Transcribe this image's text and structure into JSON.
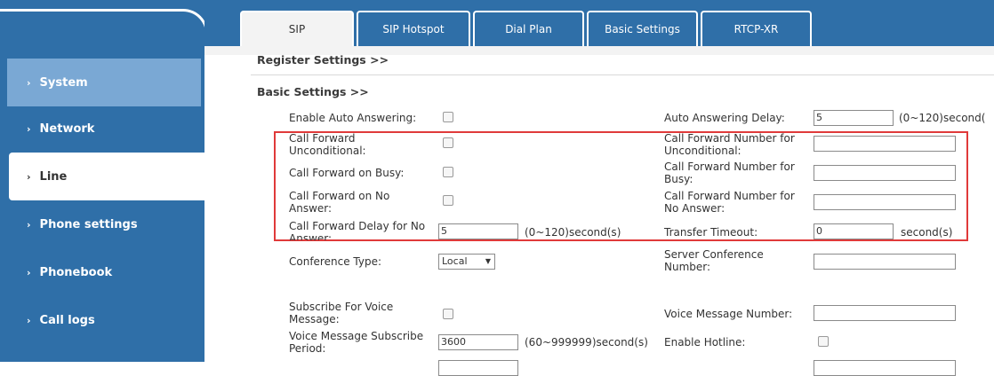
{
  "sidebar": {
    "items": [
      {
        "label": "System"
      },
      {
        "label": "Network"
      },
      {
        "label": "Line"
      },
      {
        "label": "Phone settings"
      },
      {
        "label": "Phonebook"
      },
      {
        "label": "Call logs"
      }
    ]
  },
  "tabs": [
    {
      "label": "SIP"
    },
    {
      "label": "SIP Hotspot"
    },
    {
      "label": "Dial Plan"
    },
    {
      "label": "Basic Settings"
    },
    {
      "label": "RTCP-XR"
    }
  ],
  "sections": {
    "register": "Register Settings >>",
    "basic": "Basic Settings >>"
  },
  "form": {
    "auto_answer": {
      "label": "Enable Auto Answering:"
    },
    "auto_answer_delay": {
      "label": "Auto Answering Delay:",
      "value": "5",
      "unit": "(0~120)second("
    },
    "cf_uncond": {
      "label1": "Call Forward",
      "label2": "Unconditional:"
    },
    "cf_uncond_num": {
      "label1": "Call Forward Number for",
      "label2": "Unconditional:"
    },
    "cf_busy": {
      "label": "Call Forward on Busy:"
    },
    "cf_busy_num": {
      "label1": "Call Forward Number for",
      "label2": "Busy:"
    },
    "cf_noans": {
      "label1": "Call Forward on No",
      "label2": "Answer:"
    },
    "cf_noans_num": {
      "label1": "Call Forward Number for",
      "label2": "No Answer:"
    },
    "cf_delay": {
      "label1": "Call Forward Delay for No",
      "label2": "Answer:",
      "value": "5",
      "unit": "(0~120)second(s)"
    },
    "transfer_timeout": {
      "label": "Transfer Timeout:",
      "value": "0",
      "unit": "second(s)"
    },
    "conference_type": {
      "label": "Conference Type:",
      "value": "Local",
      "arrow": "▼"
    },
    "server_conf_num": {
      "label1": "Server Conference",
      "label2": "Number:"
    },
    "subscribe_voice": {
      "label1": "Subscribe For Voice",
      "label2": "Message:"
    },
    "voice_msg_num": {
      "label": "Voice Message Number:"
    },
    "vm_subscribe_period": {
      "label1": "Voice Message Subscribe",
      "label2": "Period:",
      "value": "3600",
      "unit": "(60~999999)second(s)"
    },
    "enable_hotline": {
      "label": "Enable Hotline:"
    }
  },
  "colors": {
    "accent": "#2f6fa8",
    "selected_sidebar": "#7aa8d4",
    "highlight_box": "#e03a3a"
  }
}
